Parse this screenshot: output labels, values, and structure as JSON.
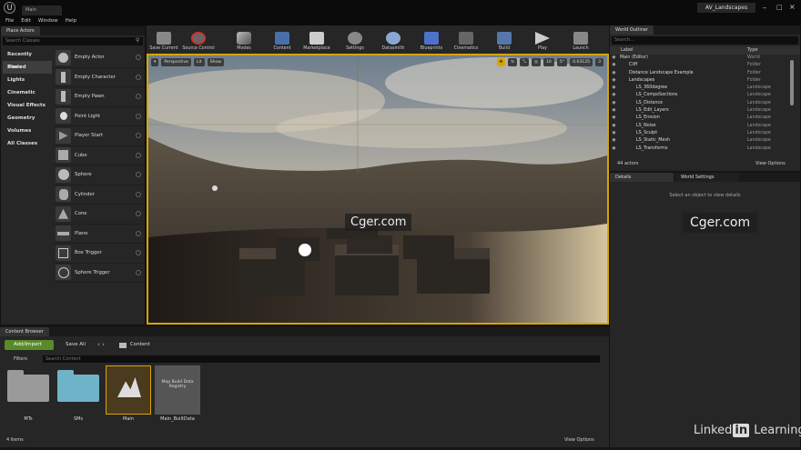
{
  "window": {
    "title": "AV_Landscapes",
    "tab": "Main"
  },
  "menu": [
    "File",
    "Edit",
    "Window",
    "Help"
  ],
  "place_actors": {
    "tab": "Place Actors",
    "search_placeholder": "Search Classes",
    "categories": [
      "Recently Placed",
      "Basic",
      "Lights",
      "Cinematic",
      "Visual Effects",
      "Geometry",
      "Volumes",
      "All Classes"
    ],
    "selected_category": "Basic",
    "items": [
      "Empty Actor",
      "Empty Character",
      "Empty Pawn",
      "Point Light",
      "Player Start",
      "Cube",
      "Sphere",
      "Cylinder",
      "Cone",
      "Plane",
      "Box Trigger",
      "Sphere Trigger"
    ]
  },
  "toolbar": [
    "Save Current",
    "Source Control",
    "Modes",
    "Content",
    "Marketplace",
    "Settings",
    "Datasmith",
    "Blueprints",
    "Cinematics",
    "Build",
    "Play",
    "Launch"
  ],
  "viewport": {
    "perspective": "Perspective",
    "lit": "Lit",
    "show": "Show",
    "grid_value": "10",
    "angle_value": "5°",
    "scale_value": "0.03125",
    "cam_speed": "3"
  },
  "outliner": {
    "tab": "World Outliner",
    "search_placeholder": "Search...",
    "col_label": "Label",
    "col_type": "Type",
    "rows": [
      {
        "label": "Main (Editor)",
        "type": "World"
      },
      {
        "label": "Cliff",
        "type": "Folder"
      },
      {
        "label": "Distance Landscape Example",
        "type": "Folder"
      },
      {
        "label": "Landscapes",
        "type": "Folder"
      },
      {
        "label": "LS_360degree",
        "type": "Landscape"
      },
      {
        "label": "LS_CompoSections",
        "type": "Landscape"
      },
      {
        "label": "LS_Distance",
        "type": "Landscape"
      },
      {
        "label": "LS_Edit_Layers",
        "type": "Landscape"
      },
      {
        "label": "LS_Erosion",
        "type": "Landscape"
      },
      {
        "label": "LS_Noise",
        "type": "Landscape"
      },
      {
        "label": "LS_Sculpt",
        "type": "Landscape"
      },
      {
        "label": "LS_Static_Mesh",
        "type": "Landscape"
      },
      {
        "label": "LS_Transforms",
        "type": "Landscape"
      }
    ],
    "count": "44 actors",
    "view_options": "View Options"
  },
  "details": {
    "tab": "Details",
    "tab2": "World Settings",
    "empty": "Select an object to view details"
  },
  "content_browser": {
    "tab": "Content Browser",
    "add_import": "Add/Import",
    "save_all": "Save All",
    "path": "Content",
    "filters": "Filters",
    "search_placeholder": "Search Content",
    "assets": [
      {
        "label": "MTs"
      },
      {
        "label": "SMs"
      },
      {
        "label": "Main"
      },
      {
        "label": "Main_BuiltData",
        "thumb_text": "Map Build Data Registry"
      }
    ],
    "count": "4 items",
    "view_options": "View Options"
  },
  "watermarks": [
    "Cger.com",
    "Cger.com"
  ],
  "branding": {
    "word": "Linked",
    "box": "in",
    "suffix": " Learning"
  },
  "colors": {
    "accent": "#d9a400",
    "add_button": "#5a8b2a",
    "folder_gray": "#9a9a9a",
    "folder_blue": "#6fb3c9"
  }
}
